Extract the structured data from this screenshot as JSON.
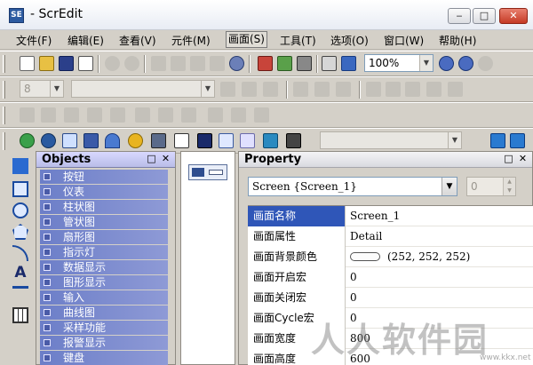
{
  "window": {
    "title": "- ScrEdit",
    "app_icon_label": "SE"
  },
  "window_controls": {
    "minimize": "‒",
    "maximize": "□",
    "close": "✕"
  },
  "menu": [
    "文件(F)",
    "编辑(E)",
    "查看(V)",
    "元件(M)",
    "画面(S)",
    "工具(T)",
    "选项(O)",
    "窗口(W)",
    "帮助(H)"
  ],
  "toolbar": {
    "zoom": "100%",
    "font_size": "8"
  },
  "objects_panel": {
    "title": "Objects",
    "items": [
      "按钮",
      "仪表",
      "柱状图",
      "管状图",
      "扇形图",
      "指示灯",
      "数据显示",
      "图形显示",
      "输入",
      "曲线图",
      "采样功能",
      "报警显示",
      "键盘"
    ]
  },
  "property_panel": {
    "title": "Property",
    "selector": "Screen {Screen_1}",
    "spin_value": "0",
    "rows": [
      {
        "name": "画面名称",
        "value": "Screen_1"
      },
      {
        "name": "画面属性",
        "value": "Detail"
      },
      {
        "name": "画面背景颜色",
        "value": "(252, 252, 252)"
      },
      {
        "name": "画面开启宏",
        "value": "0"
      },
      {
        "name": "画面关闭宏",
        "value": "0"
      },
      {
        "name": "画面Cycle宏",
        "value": "0"
      },
      {
        "name": "画面宽度",
        "value": "800"
      },
      {
        "name": "画面高度",
        "value": "600"
      }
    ]
  },
  "colors": {
    "selection": "#2f56b8",
    "objects_row": "#6c7ec8"
  },
  "watermark": {
    "text": "人人软件园",
    "url": "www.kkx.net"
  }
}
